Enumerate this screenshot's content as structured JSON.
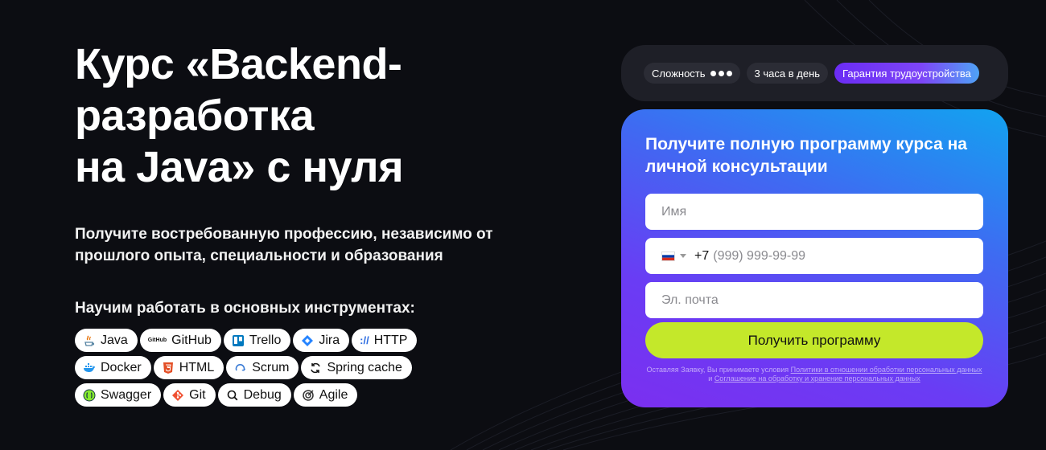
{
  "hero": {
    "title_lines": [
      "Курс «Backend-",
      "разработка",
      "на Java» с нуля"
    ],
    "subtitle": "Получите востребованную профессию, независимо от прошлого опыта, специальности и образования",
    "tools_heading": "Научим работать в основных инструментах:",
    "tools": [
      {
        "label": "Java",
        "icon": "java-icon"
      },
      {
        "label": "GitHub",
        "icon": "github-icon",
        "icon_text": "GitHub"
      },
      {
        "label": "Trello",
        "icon": "trello-icon"
      },
      {
        "label": "Jira",
        "icon": "jira-icon"
      },
      {
        "label": "HTTP",
        "icon": "http-icon",
        "icon_text": "://"
      },
      {
        "label": "Docker",
        "icon": "docker-icon"
      },
      {
        "label": "HTML",
        "icon": "html5-icon"
      },
      {
        "label": "Scrum",
        "icon": "scrum-icon"
      },
      {
        "label": "Spring cache",
        "icon": "refresh-icon"
      },
      {
        "label": "Swagger",
        "icon": "swagger-icon"
      },
      {
        "label": "Git",
        "icon": "git-icon"
      },
      {
        "label": "Debug",
        "icon": "search-icon"
      },
      {
        "label": "Agile",
        "icon": "agile-icon"
      }
    ]
  },
  "badges": {
    "difficulty": "Сложность",
    "hours": "3 часа в день",
    "guarantee": "Гарантия трудоустройства"
  },
  "form": {
    "title": "Получите полную программу курса на личной консультации",
    "name_placeholder": "Имя",
    "phone_prefix": "+7",
    "phone_placeholder": "(999) 999-99-99",
    "email_placeholder": "Эл. почта",
    "submit_label": "Получить программу",
    "disclaimer_pre": "Оставляя Заявку, Вы принимаете условия ",
    "disclaimer_link1": "Политики в отношении обработки персональных данных",
    "disclaimer_mid": " и ",
    "disclaimer_link2": "Соглашение на обработку и хранение персональных данных"
  },
  "colors": {
    "background": "#0c0d12",
    "accent_green": "#c4e82a",
    "accent_purple": "#6b2cf5"
  }
}
